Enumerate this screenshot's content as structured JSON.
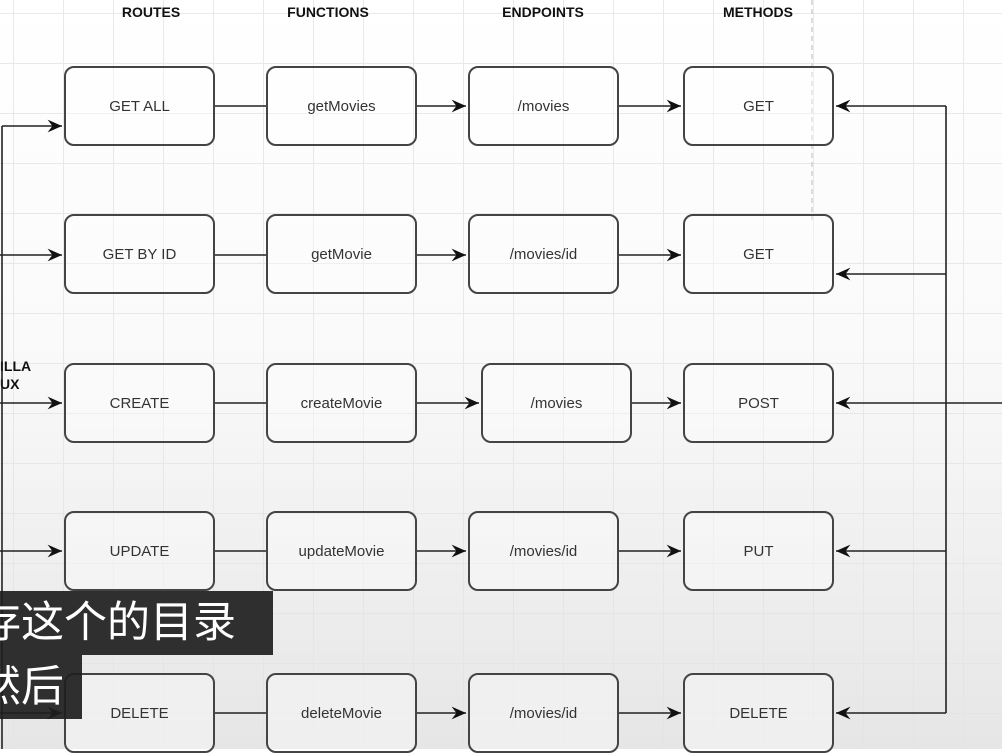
{
  "headers": {
    "routes": "ROUTES",
    "functions": "FUNCTIONS",
    "endpoints": "ENDPOINTS",
    "methods": "METHODS"
  },
  "side_label": {
    "line1": "ILLA",
    "line2": "UX"
  },
  "rows": [
    {
      "route": "GET ALL",
      "function": "getMovies",
      "endpoint": "/movies",
      "method": "GET"
    },
    {
      "route": "GET BY ID",
      "function": "getMovie",
      "endpoint": "/movies/id",
      "method": "GET"
    },
    {
      "route": "CREATE",
      "function": "createMovie",
      "endpoint": "/movies",
      "method": "POST"
    },
    {
      "route": "UPDATE",
      "function": "updateMovie",
      "endpoint": "/movies/id",
      "method": "PUT"
    },
    {
      "route": "DELETE",
      "function": "deleteMovie",
      "endpoint": "/movies/id",
      "method": "DELETE"
    }
  ],
  "subtitles": {
    "line1": "存这个的目录",
    "line2": "然后"
  }
}
